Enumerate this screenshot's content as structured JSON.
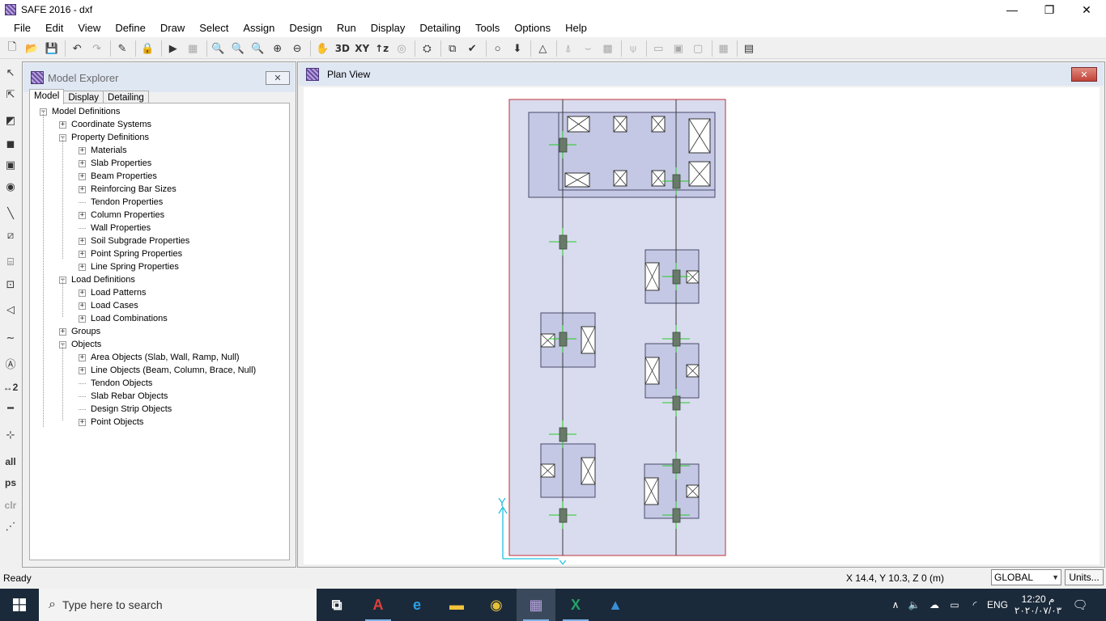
{
  "window": {
    "title": "SAFE 2016 - dxf",
    "minimize": "—",
    "maximize": "❐",
    "close": "✕"
  },
  "menu": [
    "File",
    "Edit",
    "View",
    "Define",
    "Draw",
    "Select",
    "Assign",
    "Design",
    "Run",
    "Display",
    "Detailing",
    "Tools",
    "Options",
    "Help"
  ],
  "toolbar": {
    "items": [
      {
        "name": "new-model-icon",
        "glyph": "🗋"
      },
      {
        "name": "open-icon",
        "glyph": "📂"
      },
      {
        "name": "save-icon",
        "glyph": "💾"
      },
      {
        "sep": true
      },
      {
        "name": "undo-icon",
        "glyph": "↶"
      },
      {
        "name": "redo-icon",
        "glyph": "↷",
        "disabled": true
      },
      {
        "sep": true
      },
      {
        "name": "pencil-icon",
        "glyph": "✎"
      },
      {
        "sep": true
      },
      {
        "name": "lock-icon",
        "glyph": "🔒"
      },
      {
        "sep": true
      },
      {
        "name": "run-icon",
        "glyph": "▶"
      },
      {
        "name": "run-locked-icon",
        "glyph": "▦",
        "disabled": true
      },
      {
        "sep": true
      },
      {
        "name": "zoom-window-icon",
        "glyph": "🔍"
      },
      {
        "name": "zoom-restore-icon",
        "glyph": "🔍"
      },
      {
        "name": "zoom-previous-icon",
        "glyph": "🔍"
      },
      {
        "name": "zoom-in-icon",
        "glyph": "⊕"
      },
      {
        "name": "zoom-out-icon",
        "glyph": "⊖"
      },
      {
        "sep": true
      },
      {
        "name": "pan-icon",
        "glyph": "✋"
      },
      {
        "name": "view-3d-icon",
        "text": "3D"
      },
      {
        "name": "view-xy-icon",
        "text": "XY"
      },
      {
        "name": "view-z-icon",
        "text": "↑z"
      },
      {
        "name": "rotate-icon",
        "glyph": "◎",
        "disabled": true
      },
      {
        "sep": true
      },
      {
        "name": "perspective-icon",
        "glyph": "⛭"
      },
      {
        "sep": true
      },
      {
        "name": "select-icon",
        "glyph": "⧉"
      },
      {
        "name": "check-icon",
        "glyph": "✔"
      },
      {
        "sep": true
      },
      {
        "name": "circle-icon",
        "glyph": "○"
      },
      {
        "name": "deformed-shape-icon",
        "glyph": "⬇"
      },
      {
        "sep": true
      },
      {
        "name": "triangle-icon",
        "glyph": "△"
      },
      {
        "sep": true
      },
      {
        "name": "reaction-icon",
        "glyph": "⍋",
        "disabled": true
      },
      {
        "name": "strip-icon",
        "glyph": "⌣",
        "disabled": true
      },
      {
        "name": "slab-forces-icon",
        "glyph": "▩",
        "disabled": true
      },
      {
        "sep": true
      },
      {
        "name": "soil-pressure-icon",
        "glyph": "⍦",
        "disabled": true
      },
      {
        "sep": true
      },
      {
        "name": "beam-forces-icon",
        "glyph": "▭",
        "disabled": true
      },
      {
        "name": "tendon-icon",
        "glyph": "▣",
        "disabled": true
      },
      {
        "name": "punching-icon",
        "glyph": "▢",
        "disabled": true
      },
      {
        "sep": true
      },
      {
        "name": "table-icon",
        "glyph": "▦",
        "disabled": true
      },
      {
        "sep": true
      },
      {
        "name": "display-tables-icon",
        "glyph": "▤"
      }
    ]
  },
  "vtoolbar": [
    {
      "name": "pointer-icon",
      "glyph": "↖"
    },
    {
      "name": "reshape-icon",
      "glyph": "⇱"
    },
    {
      "name": "draw-area-icon",
      "glyph": "◩"
    },
    {
      "name": "draw-rectangle-icon",
      "glyph": "◼"
    },
    {
      "name": "draw-column-icon",
      "glyph": "▣"
    },
    {
      "name": "draw-point-icon",
      "glyph": "◉"
    },
    {
      "name": "draw-line-icon",
      "glyph": "╲"
    },
    {
      "name": "draw-beam-icon",
      "glyph": "⧄"
    },
    {
      "name": "draw-wall-icon",
      "glyph": "⌸"
    },
    {
      "name": "draw-strip-icon",
      "glyph": "⊡"
    },
    {
      "name": "draw-ramp-icon",
      "glyph": "◁"
    },
    {
      "name": "draw-tendon-icon",
      "glyph": "∼"
    },
    {
      "name": "draw-rebar-icon",
      "glyph": "Ⓐ"
    },
    {
      "name": "dimension-icon",
      "text": "↔2"
    },
    {
      "name": "line-icon",
      "glyph": "━"
    },
    {
      "name": "snap-icon",
      "glyph": "⊹"
    },
    {
      "name": "select-all-icon",
      "text": "all"
    },
    {
      "name": "select-previous-icon",
      "text": "ps"
    },
    {
      "name": "clear-selection-icon",
      "text": "clr",
      "disabled": true
    },
    {
      "name": "intersecting-line-icon",
      "glyph": "⋰"
    }
  ],
  "explorer": {
    "title": "Model Explorer",
    "close": "✕",
    "tabs": [
      "Model",
      "Display",
      "Detailing"
    ],
    "tree": [
      {
        "label": "Model Definitions",
        "level": 0,
        "kind": "minus"
      },
      {
        "label": "Coordinate Systems",
        "level": 1,
        "kind": "plus"
      },
      {
        "label": "Property Definitions",
        "level": 1,
        "kind": "minus"
      },
      {
        "label": "Materials",
        "level": 2,
        "kind": "plus"
      },
      {
        "label": "Slab Properties",
        "level": 2,
        "kind": "plus"
      },
      {
        "label": "Beam Properties",
        "level": 2,
        "kind": "plus"
      },
      {
        "label": "Reinforcing Bar Sizes",
        "level": 2,
        "kind": "plus"
      },
      {
        "label": "Tendon Properties",
        "level": 2,
        "kind": "leaf"
      },
      {
        "label": "Column Properties",
        "level": 2,
        "kind": "plus"
      },
      {
        "label": "Wall Properties",
        "level": 2,
        "kind": "leaf"
      },
      {
        "label": "Soil Subgrade Properties",
        "level": 2,
        "kind": "plus"
      },
      {
        "label": "Point Spring Properties",
        "level": 2,
        "kind": "plus"
      },
      {
        "label": "Line Spring Properties",
        "level": 2,
        "kind": "plus"
      },
      {
        "label": "Load Definitions",
        "level": 1,
        "kind": "minus"
      },
      {
        "label": "Load Patterns",
        "level": 2,
        "kind": "plus"
      },
      {
        "label": "Load Cases",
        "level": 2,
        "kind": "plus"
      },
      {
        "label": "Load Combinations",
        "level": 2,
        "kind": "plus"
      },
      {
        "label": "Groups",
        "level": 1,
        "kind": "plus"
      },
      {
        "label": "Objects",
        "level": 1,
        "kind": "minus"
      },
      {
        "label": "Area Objects (Slab, Wall, Ramp, Null)",
        "level": 2,
        "kind": "plus"
      },
      {
        "label": "Line Objects (Beam, Column, Brace, Null)",
        "level": 2,
        "kind": "plus"
      },
      {
        "label": "Tendon Objects",
        "level": 2,
        "kind": "leaf"
      },
      {
        "label": "Slab Rebar Objects",
        "level": 2,
        "kind": "leaf"
      },
      {
        "label": "Design Strip Objects",
        "level": 2,
        "kind": "leaf"
      },
      {
        "label": "Point Objects",
        "level": 2,
        "kind": "plus"
      }
    ]
  },
  "planview": {
    "title": "Plan View",
    "close": "✕",
    "axis_y": "Y",
    "axis_x": "X",
    "colors": {
      "slab_border": "#c0303a",
      "slab_fill": "#d9dcee",
      "footing_fill": "#c4c8e4",
      "footing_border": "#4a4a6a",
      "column": "#6a7a6a",
      "grid_line": "#3a3a3a",
      "restraint": "#22cc22",
      "axis": "#20c0e0"
    }
  },
  "status": {
    "ready": "Ready",
    "coords": "X 14.4,  Y 10.3,  Z 0  (m)",
    "coord_system": "GLOBAL",
    "units_button": "Units..."
  },
  "taskbar": {
    "search_placeholder": "Type here to search",
    "apps": [
      {
        "name": "task-view-icon"
      },
      {
        "name": "autocad-icon"
      },
      {
        "name": "edge-icon"
      },
      {
        "name": "file-explorer-icon"
      },
      {
        "name": "chrome-icon"
      },
      {
        "name": "safe-icon",
        "active": true
      },
      {
        "name": "excel-icon"
      },
      {
        "name": "photos-icon"
      }
    ],
    "language": "ENG",
    "time": "12:20 م",
    "date": "٢٠٢٠/٠٧/٠٣"
  }
}
